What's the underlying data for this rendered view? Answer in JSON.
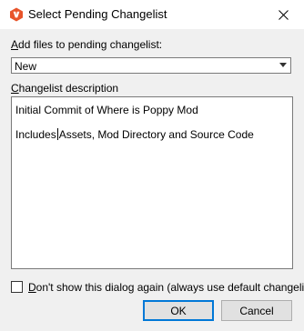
{
  "window": {
    "title": "Select Pending Changelist",
    "icon": "app-v-icon",
    "close_icon": "close-icon"
  },
  "form": {
    "add_files_label_prefix": "A",
    "add_files_label_rest": "dd files to pending changelist:",
    "changelist_select_value": "New",
    "description_label_prefix": "C",
    "description_label_rest": "hangelist description",
    "description_line1": "Initial Commit of Where is Poppy Mod",
    "description_line2_before_caret": "Includes",
    "description_line2_after_caret": "Assets, Mod Directory and Source Code",
    "dont_show_checked": false,
    "dont_show_label_prefix": "D",
    "dont_show_label_rest": "on't show this dialog again (always use default changelist)"
  },
  "buttons": {
    "ok_label": "OK",
    "cancel_label": "Cancel"
  },
  "colors": {
    "accent": "#0078d7",
    "app_icon": "#e8542a"
  }
}
